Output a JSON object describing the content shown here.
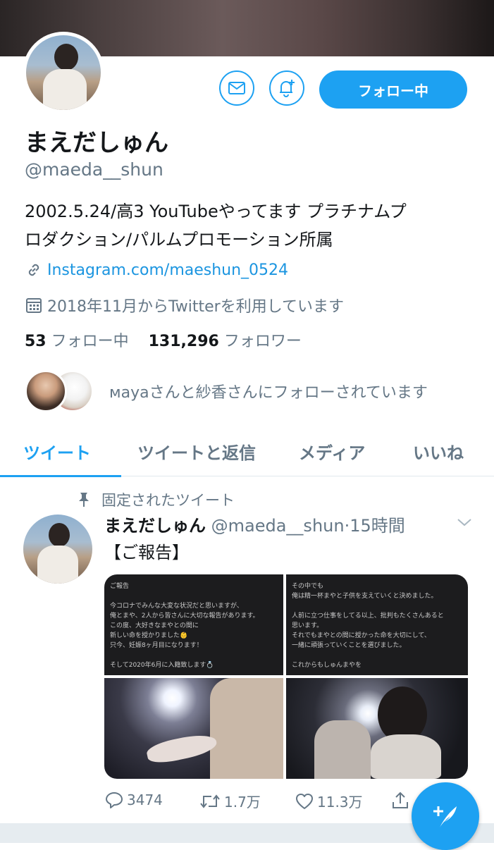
{
  "colors": {
    "accent": "#1da1f2",
    "link": "#1b95e0",
    "muted": "#657786",
    "text": "#14171a"
  },
  "profile": {
    "name": "まえだしゅん",
    "handle": "@maeda__shun",
    "bio_line1": "2002.5.24/高3 YouTubeやってます プラチナムプ",
    "bio_line2": "ロダクション/パルムプロモーション所属",
    "link": "Instagram.com/maeshun_0524",
    "joined": "2018年11月からTwitterを利用しています",
    "following_count": "53",
    "following_label": "フォロー中",
    "followers_count": "131,296",
    "followers_label": "フォロワー",
    "followed_by_text": "мayaさんと紗香さんにフォローされています"
  },
  "actions": {
    "message_icon": "mail-icon",
    "notify_icon": "bell-plus-icon",
    "follow_label": "フォロー中"
  },
  "tabs": [
    {
      "label": "ツイート",
      "active": true
    },
    {
      "label": "ツイートと返信",
      "active": false
    },
    {
      "label": "メディア",
      "active": false
    },
    {
      "label": "いいね",
      "active": false
    }
  ],
  "tweet": {
    "pinned_label": "固定されたツイート",
    "name": "まえだしゅん",
    "handle": "@maeda__shun",
    "time": "·15時間",
    "text": "【ご報告】",
    "note1_lines": [
      "ご報告",
      "",
      "今コロナでみんな大変な状況だと思いますが、",
      "俺とまや、2人から皆さんに大切な報告があります。",
      "この度、大好きなまやとの間に",
      "新しい命を授かりました👶",
      "只今、妊娠8ヶ月目になります！",
      "",
      "そして2020年6月に入籍致します💍"
    ],
    "note2_lines": [
      "その中でも",
      "俺は精一杯まやと子供を支えていくと決めました。",
      "",
      "人前に立つ仕事をしてる以上、批判もたくさんあると",
      "思います。",
      "それでもまやとの間に授かった命を大切にして、",
      "一緒に頑張っていくことを選びました。",
      "",
      "これからもしゅんまやを"
    ],
    "replies": "3474",
    "retweets": "1.7万",
    "likes": "11.3万"
  },
  "fab_icon": "compose-icon"
}
